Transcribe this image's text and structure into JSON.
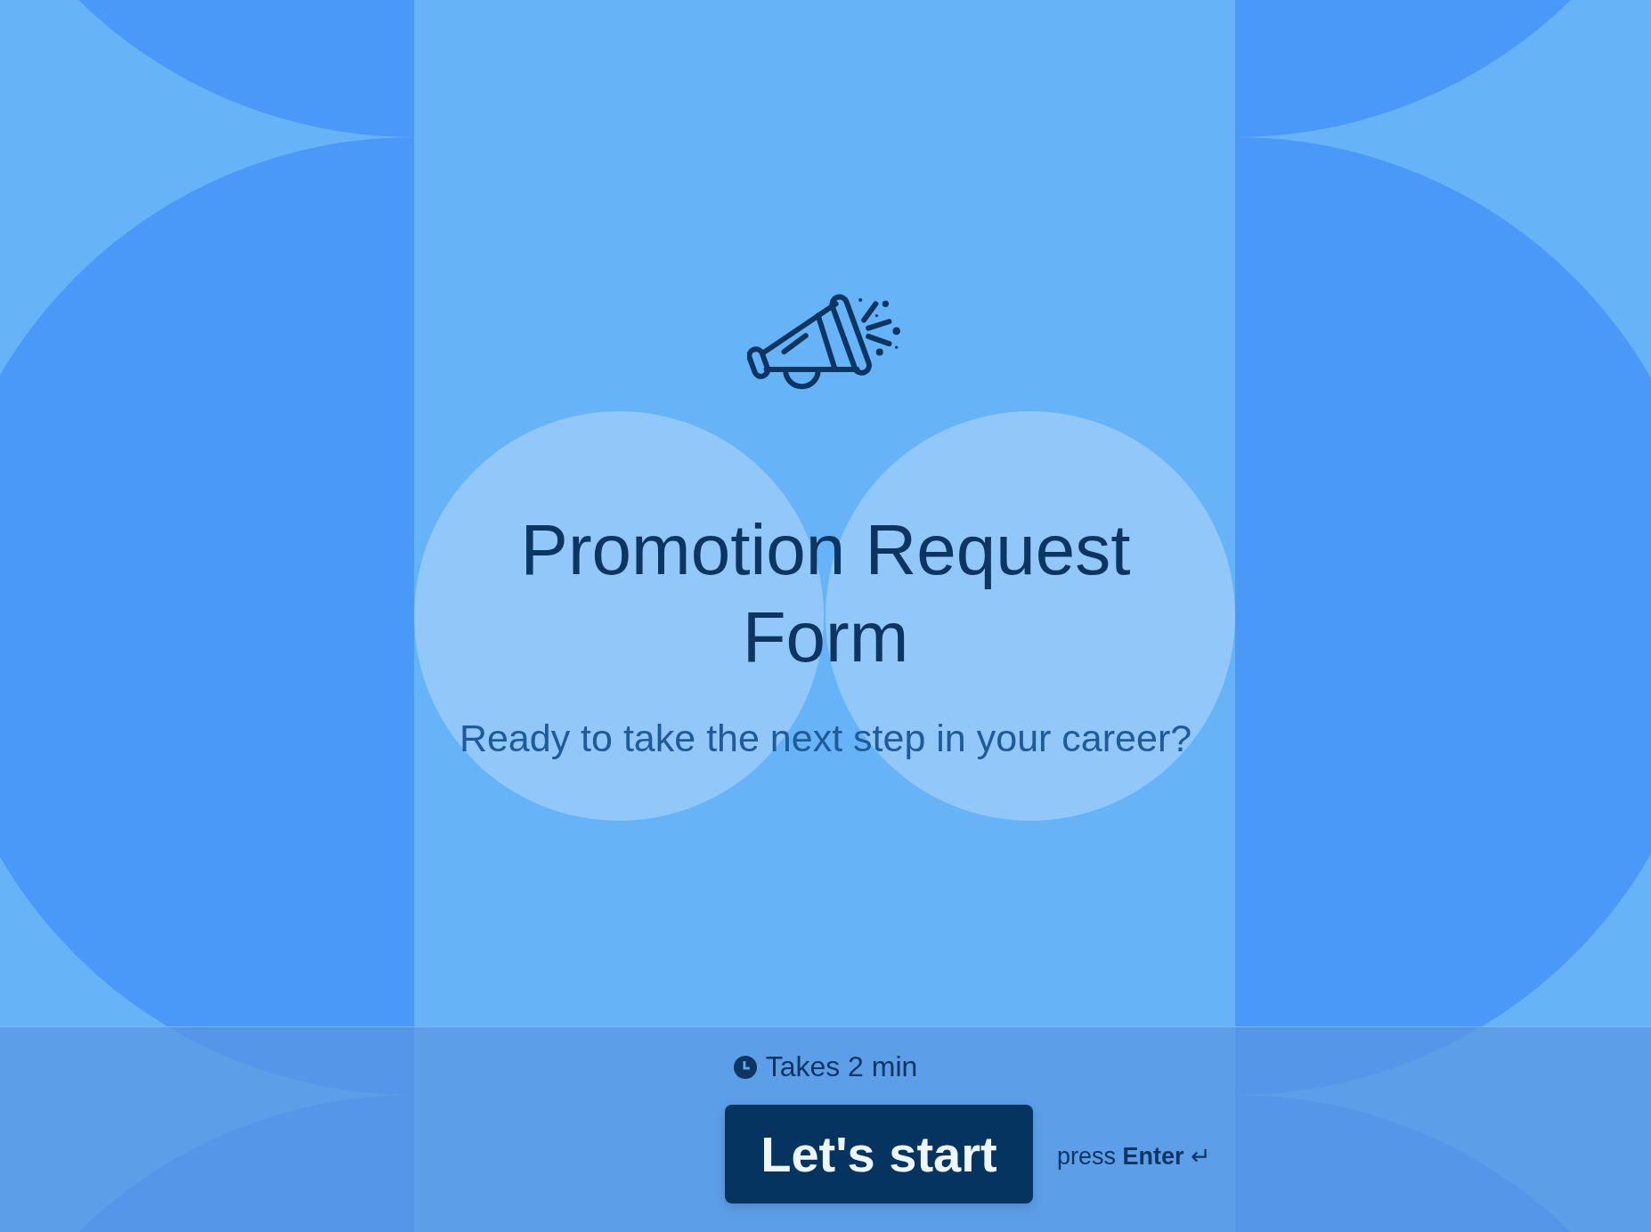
{
  "form": {
    "title": "Promotion Request Form",
    "subtitle": "Ready to take the next step in your career?"
  },
  "footer": {
    "duration": "Takes 2 min",
    "start_button": "Let's start",
    "hint": "press **Enter** ↵"
  }
}
